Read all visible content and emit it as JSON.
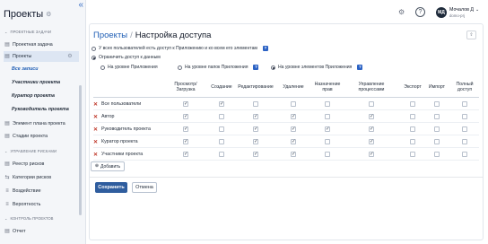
{
  "sidebar": {
    "title": "Проекты",
    "groups": {
      "project_tasks": "ПРОЕКТНЫЕ ЗАДАЧИ",
      "risk_management": "УПРАВЛЕНИЕ РИСКАМИ",
      "project_control": "КОНТРОЛЬ ПРОЕКТОВ"
    },
    "items": {
      "project_task": "Проектная задача",
      "projects": "Проекты",
      "all_records": "Все записи",
      "project_participants": "Участники проекта",
      "project_curator": "Куратор проекта",
      "project_manager": "Руководитель проекта",
      "plan_element": "Элемент плана проекта",
      "project_stages": "Стадии проекта",
      "risk_registry": "Реестр рисков",
      "risk_categories": "Категории рисков",
      "impact": "Воздействие",
      "probability": "Вероятность",
      "report": "Отчет"
    }
  },
  "header": {
    "help": "?",
    "avatar_initials": "МД",
    "user_name": "Мочалов Д",
    "domain": "domo-prj"
  },
  "page": {
    "breadcrumb_link": "Проекты",
    "breadcrumb_sep": "/",
    "title": "Настройка доступа",
    "panel_button": "⇧"
  },
  "access": {
    "option_all": "У всех пользователей есть доступ к Приложению и ко всем его элементам",
    "option_restrict": "Ограничить доступ к данным",
    "level_app": "На уровне Приложения",
    "level_folders": "На уровне папок Приложения",
    "level_elements": "На уровне элементов Приложения",
    "selected_option": "restrict",
    "selected_level": "elements",
    "help_mark": "?"
  },
  "table": {
    "columns": [
      "Просмотр/ Загрузка",
      "Создание",
      "Редактирование",
      "Удаление",
      "Назначение прав",
      "Управление процессами",
      "Экспорт",
      "Импорт",
      "Полный доступ"
    ],
    "rows": [
      {
        "name": "Все пользователи",
        "checks": [
          true,
          true,
          false,
          false,
          false,
          false,
          false,
          false,
          false
        ]
      },
      {
        "name": "Автор",
        "checks": [
          true,
          false,
          true,
          true,
          false,
          true,
          false,
          false,
          false
        ]
      },
      {
        "name": "Руководитель проекта",
        "checks": [
          true,
          false,
          true,
          true,
          true,
          true,
          false,
          false,
          false
        ]
      },
      {
        "name": "Куратор проекта",
        "checks": [
          true,
          false,
          true,
          true,
          false,
          true,
          false,
          false,
          false
        ]
      },
      {
        "name": "Участники проекта",
        "checks": [
          true,
          false,
          true,
          true,
          false,
          true,
          false,
          false,
          false
        ]
      }
    ]
  },
  "buttons": {
    "add": "Добавить",
    "save": "Сохранить",
    "cancel": "Отмена"
  },
  "colors": {
    "accent": "#1e5db4",
    "primary_button": "#2f5d9e",
    "delete_mark": "#c0392b"
  }
}
